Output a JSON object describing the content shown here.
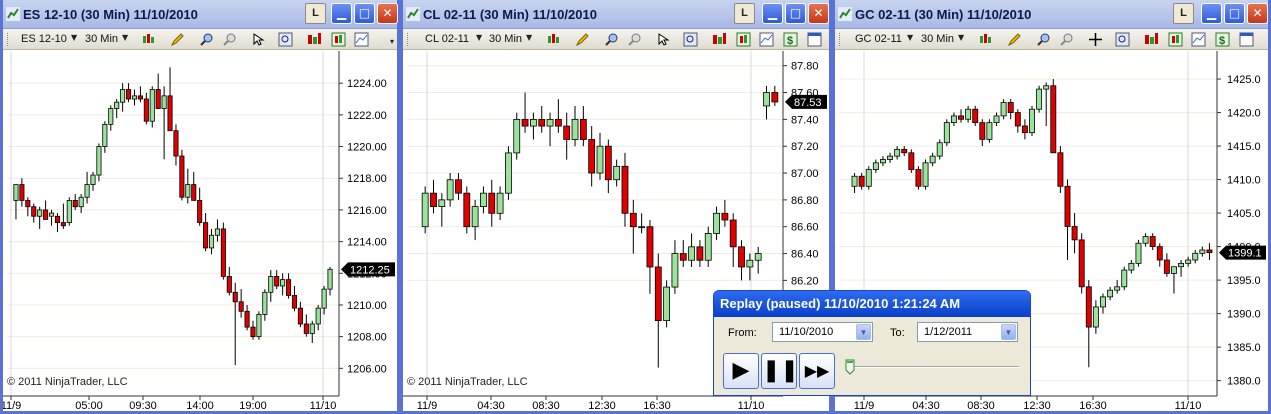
{
  "windows": [
    {
      "title": "ES 12-10 (30 Min)  11/10/2010",
      "instrument": "ES 12-10",
      "interval": "30 Min",
      "copyright": "© 2011 NinjaTrader, LLC",
      "price_marker": "1212.25",
      "chart_data": {
        "type": "candlestick",
        "y_ticks": [
          "1224.00",
          "1222.00",
          "1220.00",
          "1218.00",
          "1216.00",
          "1214.00",
          "1212.00",
          "1210.00",
          "1208.00",
          "1206.00"
        ],
        "ylim": [
          1205.2,
          1225.4
        ],
        "x_ticks": [
          "11/9",
          "05:00",
          "09:30",
          "14:00",
          "19:00",
          "11/10"
        ],
        "candles": [
          [
            1216.6,
            1217.6,
            1215.4,
            1217.6
          ],
          [
            1217.6,
            1218.0,
            1216.2,
            1216.6
          ],
          [
            1216.6,
            1216.8,
            1215.6,
            1216.2
          ],
          [
            1216.2,
            1216.4,
            1215.2,
            1215.6
          ],
          [
            1215.6,
            1216.2,
            1214.8,
            1216.0
          ],
          [
            1216.0,
            1216.6,
            1215.4,
            1215.4
          ],
          [
            1215.6,
            1216.0,
            1215.0,
            1215.8
          ],
          [
            1215.6,
            1215.8,
            1214.6,
            1215.2
          ],
          [
            1215.2,
            1216.4,
            1214.8,
            1215.0
          ],
          [
            1215.2,
            1216.8,
            1215.0,
            1216.6
          ],
          [
            1216.6,
            1217.0,
            1216.0,
            1216.2
          ],
          [
            1216.2,
            1217.0,
            1215.8,
            1216.8
          ],
          [
            1216.8,
            1218.4,
            1216.4,
            1217.6
          ],
          [
            1217.6,
            1218.4,
            1217.2,
            1218.2
          ],
          [
            1218.2,
            1220.2,
            1217.8,
            1220.0
          ],
          [
            1220.0,
            1221.6,
            1219.6,
            1221.4
          ],
          [
            1221.4,
            1222.6,
            1221.0,
            1222.4
          ],
          [
            1222.4,
            1223.0,
            1221.8,
            1222.8
          ],
          [
            1222.8,
            1224.0,
            1222.2,
            1223.6
          ],
          [
            1223.6,
            1224.0,
            1222.8,
            1223.0
          ],
          [
            1223.0,
            1223.6,
            1222.6,
            1223.2
          ],
          [
            1223.2,
            1223.8,
            1222.8,
            1223.0
          ],
          [
            1223.0,
            1223.4,
            1221.4,
            1221.6
          ],
          [
            1221.6,
            1223.8,
            1221.2,
            1223.6
          ],
          [
            1223.6,
            1224.6,
            1223.0,
            1222.4
          ],
          [
            1222.4,
            1223.8,
            1219.2,
            1223.2
          ],
          [
            1223.2,
            1225.0,
            1222.4,
            1221.0
          ],
          [
            1221.0,
            1221.4,
            1218.8,
            1219.4
          ],
          [
            1219.4,
            1219.8,
            1216.6,
            1216.8
          ],
          [
            1216.8,
            1218.6,
            1216.4,
            1217.6
          ],
          [
            1217.6,
            1218.4,
            1216.8,
            1216.6
          ],
          [
            1216.6,
            1217.4,
            1215.0,
            1215.2
          ],
          [
            1215.2,
            1215.8,
            1213.4,
            1213.6
          ],
          [
            1213.6,
            1214.8,
            1213.2,
            1214.4
          ],
          [
            1214.4,
            1215.4,
            1214.0,
            1214.8
          ],
          [
            1214.8,
            1215.2,
            1211.6,
            1211.8
          ],
          [
            1211.8,
            1212.4,
            1210.6,
            1210.8
          ],
          [
            1210.8,
            1211.4,
            1206.2,
            1210.2
          ],
          [
            1210.2,
            1211.0,
            1209.2,
            1209.6
          ],
          [
            1209.6,
            1210.0,
            1208.4,
            1208.6
          ],
          [
            1208.6,
            1209.0,
            1207.8,
            1208.0
          ],
          [
            1208.0,
            1209.6,
            1207.8,
            1209.4
          ],
          [
            1209.4,
            1211.0,
            1209.0,
            1210.8
          ],
          [
            1210.8,
            1212.2,
            1210.2,
            1211.8
          ],
          [
            1211.8,
            1212.2,
            1211.0,
            1211.2
          ],
          [
            1211.2,
            1212.0,
            1210.6,
            1211.6
          ],
          [
            1211.6,
            1212.0,
            1210.4,
            1210.6
          ],
          [
            1210.6,
            1211.2,
            1209.6,
            1209.8
          ],
          [
            1209.8,
            1210.2,
            1208.6,
            1208.8
          ],
          [
            1208.8,
            1209.4,
            1208.0,
            1208.2
          ],
          [
            1208.2,
            1209.0,
            1207.6,
            1208.8
          ],
          [
            1208.8,
            1210.0,
            1208.4,
            1209.8
          ],
          [
            1209.8,
            1211.2,
            1209.4,
            1211.0
          ],
          [
            1211.0,
            1212.4,
            1210.6,
            1212.25
          ]
        ]
      }
    },
    {
      "title": "CL 02-11 (30 Min)  11/10/2010",
      "instrument": "CL 02-11",
      "interval": "30 Min",
      "copyright": "© 2011 NinjaTrader, LLC",
      "price_marker": "87.53",
      "chart_data": {
        "type": "candlestick",
        "y_ticks": [
          "87.80",
          "87.60",
          "87.40",
          "87.20",
          "87.00",
          "86.80",
          "86.60",
          "86.40",
          "86.20"
        ],
        "ylim": [
          85.45,
          87.85
        ],
        "x_ticks": [
          "11/9",
          "04:30",
          "08:30",
          "12:30",
          "16:30",
          "11/10"
        ],
        "candles": [
          [
            86.6,
            86.9,
            86.55,
            86.85
          ],
          [
            86.85,
            86.95,
            86.7,
            86.75
          ],
          [
            86.75,
            86.85,
            86.6,
            86.8
          ],
          [
            86.8,
            87.0,
            86.75,
            86.95
          ],
          [
            86.95,
            87.0,
            86.8,
            86.85
          ],
          [
            86.85,
            86.9,
            86.55,
            86.6
          ],
          [
            86.6,
            86.8,
            86.5,
            86.75
          ],
          [
            86.75,
            86.9,
            86.7,
            86.85
          ],
          [
            86.85,
            86.95,
            86.6,
            86.7
          ],
          [
            86.7,
            86.9,
            86.65,
            86.85
          ],
          [
            86.85,
            87.2,
            86.8,
            87.15
          ],
          [
            87.15,
            87.45,
            87.1,
            87.4
          ],
          [
            87.4,
            87.6,
            87.3,
            87.35
          ],
          [
            87.35,
            87.45,
            87.25,
            87.4
          ],
          [
            87.4,
            87.5,
            87.3,
            87.35
          ],
          [
            87.35,
            87.45,
            87.2,
            87.4
          ],
          [
            87.4,
            87.55,
            87.3,
            87.35
          ],
          [
            87.35,
            87.45,
            87.1,
            87.25
          ],
          [
            87.25,
            87.5,
            87.2,
            87.4
          ],
          [
            87.4,
            87.5,
            87.2,
            87.25
          ],
          [
            87.25,
            87.35,
            86.9,
            87.0
          ],
          [
            87.0,
            87.3,
            86.95,
            87.2
          ],
          [
            87.2,
            87.25,
            86.85,
            86.95
          ],
          [
            86.95,
            87.1,
            86.9,
            87.05
          ],
          [
            87.05,
            87.15,
            86.6,
            86.7
          ],
          [
            86.7,
            86.8,
            86.4,
            86.6
          ],
          [
            86.6,
            86.7,
            86.55,
            86.6
          ],
          [
            86.6,
            86.65,
            86.1,
            86.3
          ],
          [
            86.3,
            86.4,
            85.55,
            85.9
          ],
          [
            85.9,
            86.2,
            85.85,
            86.15
          ],
          [
            86.15,
            86.5,
            86.1,
            86.4
          ],
          [
            86.4,
            86.5,
            86.3,
            86.35
          ],
          [
            86.35,
            86.55,
            86.3,
            86.45
          ],
          [
            86.45,
            86.5,
            86.3,
            86.35
          ],
          [
            86.35,
            86.6,
            86.3,
            86.55
          ],
          [
            86.55,
            86.75,
            86.5,
            86.7
          ],
          [
            86.7,
            86.8,
            86.6,
            86.65
          ],
          [
            86.65,
            86.7,
            86.3,
            86.45
          ],
          [
            86.45,
            86.5,
            86.2,
            86.3
          ],
          [
            86.3,
            86.4,
            86.2,
            86.35
          ],
          [
            86.35,
            86.45,
            86.25,
            86.4
          ],
          [
            87.5,
            87.65,
            87.4,
            87.6
          ],
          [
            87.6,
            87.65,
            87.5,
            87.53
          ]
        ]
      }
    },
    {
      "title": "GC 02-11 (30 Min)  11/10/2010",
      "instrument": "GC 02-11",
      "interval": "30 Min",
      "price_marker": "1399.1",
      "chart_data": {
        "type": "candlestick",
        "y_ticks": [
          "1425.0",
          "1420.0",
          "1415.0",
          "1410.0",
          "1405.0",
          "1400.0",
          "1395.0",
          "1390.0",
          "1385.0",
          "1380.0"
        ],
        "ylim": [
          1379.5,
          1426.5
        ],
        "x_ticks": [
          "11/9",
          "04:30",
          "08:30",
          "12:30",
          "16:30",
          "11/10"
        ],
        "candles": [
          [
            1409,
            1411,
            1408,
            1410.5
          ],
          [
            1410.5,
            1411,
            1408.5,
            1409
          ],
          [
            1409,
            1412,
            1408.5,
            1411.5
          ],
          [
            1411.5,
            1413,
            1411,
            1412.5
          ],
          [
            1412.5,
            1413.5,
            1412,
            1413
          ],
          [
            1413,
            1414,
            1412.5,
            1413.5
          ],
          [
            1413.5,
            1415,
            1413,
            1414.5
          ],
          [
            1414.5,
            1415,
            1413.5,
            1414
          ],
          [
            1414,
            1414.5,
            1411,
            1411.5
          ],
          [
            1411.5,
            1412,
            1408.5,
            1409
          ],
          [
            1409,
            1413,
            1408.5,
            1412.5
          ],
          [
            1412.5,
            1414,
            1412,
            1413.5
          ],
          [
            1413.5,
            1416,
            1413,
            1415.5
          ],
          [
            1415.5,
            1419,
            1415,
            1418.5
          ],
          [
            1418.5,
            1420,
            1418,
            1419.5
          ],
          [
            1419.5,
            1420.5,
            1418.5,
            1419
          ],
          [
            1419,
            1421,
            1418.5,
            1420.5
          ],
          [
            1420.5,
            1421,
            1418,
            1418.5
          ],
          [
            1418.5,
            1419,
            1415,
            1416
          ],
          [
            1416,
            1419,
            1415.5,
            1418.5
          ],
          [
            1418.5,
            1420,
            1418,
            1419.5
          ],
          [
            1419.5,
            1422,
            1419,
            1421.5
          ],
          [
            1421.5,
            1422,
            1419,
            1420
          ],
          [
            1420,
            1420.5,
            1417,
            1418
          ],
          [
            1418,
            1419,
            1416,
            1417
          ],
          [
            1417,
            1421,
            1416.5,
            1420.5
          ],
          [
            1420.5,
            1424,
            1420,
            1423.5
          ],
          [
            1423.5,
            1424.5,
            1418,
            1424
          ],
          [
            1424,
            1425,
            1418,
            1414
          ],
          [
            1414,
            1415,
            1408,
            1409
          ],
          [
            1409,
            1410,
            1398,
            1403
          ],
          [
            1403,
            1405,
            1399,
            1401
          ],
          [
            1401,
            1402,
            1393,
            1394
          ],
          [
            1394,
            1395,
            1382,
            1388
          ],
          [
            1388,
            1392,
            1387,
            1391
          ],
          [
            1391,
            1393,
            1390,
            1392.5
          ],
          [
            1392.5,
            1394,
            1392,
            1393.5
          ],
          [
            1393.5,
            1395,
            1393,
            1394
          ],
          [
            1394,
            1397,
            1393.5,
            1396.5
          ],
          [
            1396.5,
            1398,
            1396,
            1397.5
          ],
          [
            1397.5,
            1401,
            1397,
            1400.5
          ],
          [
            1400.5,
            1402,
            1400,
            1401.5
          ],
          [
            1401.5,
            1402,
            1399.5,
            1400
          ],
          [
            1400,
            1400.5,
            1397,
            1398
          ],
          [
            1398,
            1399,
            1395.5,
            1396
          ],
          [
            1396,
            1397,
            1393,
            1397
          ],
          [
            1397,
            1398,
            1395.5,
            1397.5
          ],
          [
            1397.5,
            1398.5,
            1397,
            1398
          ],
          [
            1398,
            1399.5,
            1397.5,
            1399
          ],
          [
            1399,
            1400,
            1398.5,
            1399.5
          ],
          [
            1399.5,
            1400.5,
            1398,
            1399.1
          ]
        ]
      }
    }
  ],
  "replay": {
    "title": "Replay (paused) 11/10/2010 1:21:24 AM",
    "from_label": "From:",
    "from_date": "11/10/2010",
    "to_label": "To:",
    "to_date": "1/12/2011",
    "progress": 0.0
  },
  "colors": {
    "up": "#9be39b",
    "down": "#e00000",
    "window_border": "#5a72d6",
    "title_gradient": "#b9c7ee"
  }
}
